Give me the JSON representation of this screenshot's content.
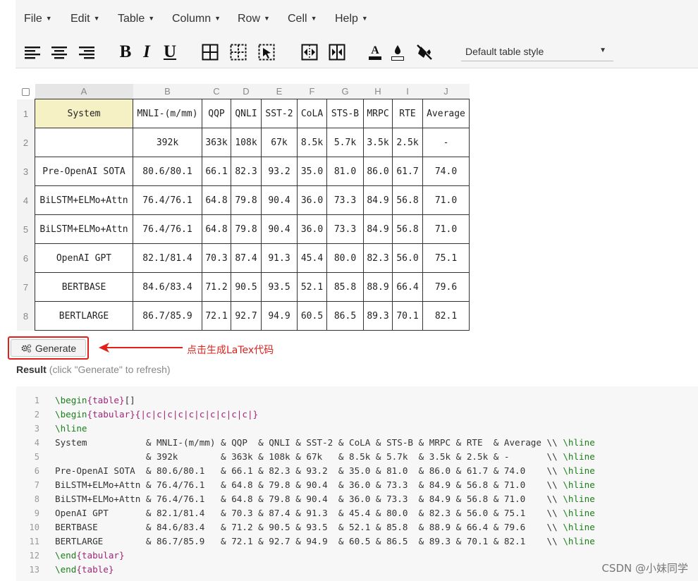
{
  "menu": [
    "File",
    "Edit",
    "Table",
    "Column",
    "Row",
    "Cell",
    "Help"
  ],
  "toolbar": {
    "bold": "B",
    "italic": "I",
    "underline": "U",
    "font_color_letter": "A",
    "style_select_value": "Default table style"
  },
  "grid": {
    "columns": [
      "A",
      "B",
      "C",
      "D",
      "E",
      "F",
      "G",
      "H",
      "I",
      "J"
    ],
    "rows": [
      {
        "num": "1",
        "cells": [
          "System",
          "MNLI-(m/mm)",
          "QQP",
          "QNLI",
          "SST-2",
          "CoLA",
          "STS-B",
          "MRPC",
          "RTE",
          "Average"
        ]
      },
      {
        "num": "2",
        "cells": [
          "",
          "392k",
          "363k",
          "108k",
          "67k",
          "8.5k",
          "5.7k",
          "3.5k",
          "2.5k",
          "-"
        ]
      },
      {
        "num": "3",
        "cells": [
          "Pre-OpenAI SOTA",
          "80.6/80.1",
          "66.1",
          "82.3",
          "93.2",
          "35.0",
          "81.0",
          "86.0",
          "61.7",
          "74.0"
        ]
      },
      {
        "num": "4",
        "cells": [
          "BiLSTM+ELMo+Attn",
          "76.4/76.1",
          "64.8",
          "79.8",
          "90.4",
          "36.0",
          "73.3",
          "84.9",
          "56.8",
          "71.0"
        ]
      },
      {
        "num": "5",
        "cells": [
          "BiLSTM+ELMo+Attn",
          "76.4/76.1",
          "64.8",
          "79.8",
          "90.4",
          "36.0",
          "73.3",
          "84.9",
          "56.8",
          "71.0"
        ]
      },
      {
        "num": "6",
        "cells": [
          "OpenAI GPT",
          "82.1/81.4",
          "70.3",
          "87.4",
          "91.3",
          "45.4",
          "80.0",
          "82.3",
          "56.0",
          "75.1"
        ]
      },
      {
        "num": "7",
        "cells": [
          "BERTBASE",
          "84.6/83.4",
          "71.2",
          "90.5",
          "93.5",
          "52.1",
          "85.8",
          "88.9",
          "66.4",
          "79.6"
        ]
      },
      {
        "num": "8",
        "cells": [
          "BERTLARGE",
          "86.7/85.9",
          "72.1",
          "92.7",
          "94.9",
          "60.5",
          "86.5",
          "89.3",
          "70.1",
          "82.1"
        ]
      }
    ]
  },
  "generate": {
    "label": "Generate",
    "annotation": "点击生成LaTex代码"
  },
  "result": {
    "label": "Result",
    "hint": "(click \"Generate\" to refresh)"
  },
  "code_lines": [
    [
      [
        "kw",
        "\\begin"
      ],
      [
        "arg",
        "{table}"
      ],
      [
        "plain",
        "[]"
      ]
    ],
    [
      [
        "kw",
        "\\begin"
      ],
      [
        "arg",
        "{tabular}"
      ],
      [
        "arg",
        "{|c|c|c|c|c|c|c|c|c|c|}"
      ]
    ],
    [
      [
        "kw",
        "\\hline"
      ]
    ],
    [
      [
        "plain",
        "System           & MNLI-(m/mm) & QQP  & QNLI & SST-2 & CoLA & STS-B & MRPC & RTE  & Average \\\\ "
      ],
      [
        "kw",
        "\\hline"
      ]
    ],
    [
      [
        "plain",
        "                 & 392k        & 363k & 108k & 67k   & 8.5k & 5.7k  & 3.5k & 2.5k & -       \\\\ "
      ],
      [
        "kw",
        "\\hline"
      ]
    ],
    [
      [
        "plain",
        "Pre-OpenAI SOTA  & 80.6/80.1   & 66.1 & 82.3 & 93.2  & 35.0 & 81.0  & 86.0 & 61.7 & 74.0    \\\\ "
      ],
      [
        "kw",
        "\\hline"
      ]
    ],
    [
      [
        "plain",
        "BiLSTM+ELMo+Attn & 76.4/76.1   & 64.8 & 79.8 & 90.4  & 36.0 & 73.3  & 84.9 & 56.8 & 71.0    \\\\ "
      ],
      [
        "kw",
        "\\hline"
      ]
    ],
    [
      [
        "plain",
        "BiLSTM+ELMo+Attn & 76.4/76.1   & 64.8 & 79.8 & 90.4  & 36.0 & 73.3  & 84.9 & 56.8 & 71.0    \\\\ "
      ],
      [
        "kw",
        "\\hline"
      ]
    ],
    [
      [
        "plain",
        "OpenAI GPT       & 82.1/81.4   & 70.3 & 87.4 & 91.3  & 45.4 & 80.0  & 82.3 & 56.0 & 75.1    \\\\ "
      ],
      [
        "kw",
        "\\hline"
      ]
    ],
    [
      [
        "plain",
        "BERTBASE         & 84.6/83.4   & 71.2 & 90.5 & 93.5  & 52.1 & 85.8  & 88.9 & 66.4 & 79.6    \\\\ "
      ],
      [
        "kw",
        "\\hline"
      ]
    ],
    [
      [
        "plain",
        "BERTLARGE        & 86.7/85.9   & 72.1 & 92.7 & 94.9  & 60.5 & 86.5  & 89.3 & 70.1 & 82.1    \\\\ "
      ],
      [
        "kw",
        "\\hline"
      ]
    ],
    [
      [
        "kw",
        "\\end"
      ],
      [
        "arg",
        "{tabular}"
      ]
    ],
    [
      [
        "kw",
        "\\end"
      ],
      [
        "arg",
        "{table}"
      ]
    ]
  ],
  "watermark": "CSDN @小妹同学"
}
